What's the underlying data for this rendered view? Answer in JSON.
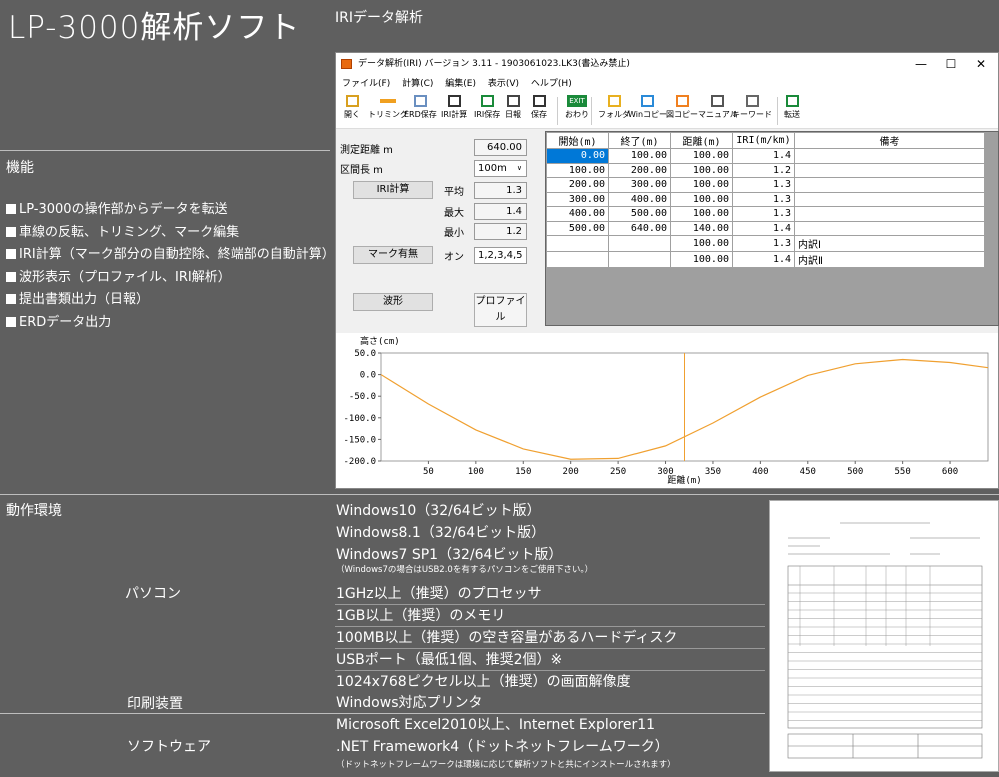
{
  "header": {
    "title": "LP-3000解析ソフト",
    "subtitle": "IRIデータ解析"
  },
  "features": {
    "heading": "機能",
    "items": [
      "LP-3000の操作部からデータを転送",
      "車線の反転、トリミング、マーク編集",
      "IRI計算（マーク部分の自動控除、終端部の自動計算）",
      "波形表示（プロファイル、IRI解析）",
      "提出書類出力（日報）",
      "ERDデータ出力"
    ]
  },
  "window": {
    "title": "データ解析(IRI) バージョン 3.11 - 1903061023.LK3(書込み禁止)",
    "controls": [
      "—",
      "☐",
      "✕"
    ],
    "menu": [
      "ファイル(F)",
      "計算(C)",
      "編集(E)",
      "表示(V)",
      "ヘルプ(H)"
    ],
    "toolbar": [
      {
        "label": "開く",
        "icon": "open-folder-icon"
      },
      {
        "label": "トリミング",
        "icon": "trim-icon"
      },
      {
        "label": "ERD保存",
        "icon": "erd-save-icon"
      },
      {
        "label": "IRI計算",
        "icon": "calculator-icon"
      },
      {
        "label": "IRI保存",
        "icon": "excel-icon"
      },
      {
        "label": "日報",
        "icon": "document-icon"
      },
      {
        "label": "保存",
        "icon": "save-icon"
      },
      {
        "label": "おわり",
        "icon": "exit-icon",
        "text": "EXIT"
      },
      {
        "label": "フォルダ",
        "icon": "folder-icon"
      },
      {
        "label": "Winコピー",
        "icon": "window-copy-icon"
      },
      {
        "label": "図コピー",
        "icon": "figure-copy-icon"
      },
      {
        "label": "マニュアル",
        "icon": "book-icon"
      },
      {
        "label": "キーワード",
        "icon": "keyword-icon"
      },
      {
        "label": "転送",
        "icon": "transfer-icon"
      }
    ],
    "left": {
      "dist_label": "測定距離 m",
      "dist_value": "640.00",
      "interval_label": "区間長 m",
      "interval_value": "100m",
      "iri_btn": "IRI計算",
      "avg_label": "平均",
      "avg_value": "1.3",
      "max_label": "最大",
      "max_value": "1.4",
      "min_label": "最小",
      "min_value": "1.2",
      "mark_btn": "マーク有無",
      "mark_on_label": "オン",
      "mark_values": "1,2,3,4,5",
      "wave_btn": "波形",
      "profile_btn": "プロファイル"
    },
    "table": {
      "headers": [
        "開始(m)",
        "終了(m)",
        "距離(m)",
        "IRI(m/km)",
        "備考"
      ],
      "rows": [
        [
          "0.00",
          "100.00",
          "100.00",
          "1.4",
          ""
        ],
        [
          "100.00",
          "200.00",
          "100.00",
          "1.2",
          ""
        ],
        [
          "200.00",
          "300.00",
          "100.00",
          "1.3",
          ""
        ],
        [
          "300.00",
          "400.00",
          "100.00",
          "1.3",
          ""
        ],
        [
          "400.00",
          "500.00",
          "100.00",
          "1.3",
          ""
        ],
        [
          "500.00",
          "640.00",
          "140.00",
          "1.4",
          ""
        ],
        [
          "",
          "",
          "100.00",
          "1.3",
          "内訳Ⅰ"
        ],
        [
          "",
          "",
          "100.00",
          "1.4",
          "内訳Ⅱ"
        ]
      ]
    },
    "chart_data": {
      "type": "line",
      "ylabel": "高さ(cm)",
      "xlabel": "距離(m)",
      "xlim": [
        0,
        640
      ],
      "ylim": [
        -200,
        50
      ],
      "xticks": [
        50,
        100,
        150,
        200,
        250,
        300,
        350,
        400,
        450,
        500,
        550,
        600
      ],
      "yticks": [
        "50.0",
        "0.0",
        "-50.0",
        "-100.0",
        "-150.0",
        "-200.0"
      ],
      "cursor_x": 320,
      "color": "#f0a030",
      "x": [
        0,
        50,
        100,
        150,
        200,
        250,
        300,
        350,
        400,
        450,
        500,
        550,
        600,
        640
      ],
      "y": [
        0,
        -68,
        -128,
        -172,
        -196,
        -194,
        -165,
        -112,
        -52,
        -2,
        25,
        35,
        28,
        16
      ]
    }
  },
  "environment": {
    "heading": "動作環境",
    "pc_label": "パソコン",
    "os": [
      "Windows10（32/64ビット版）",
      "Windows8.1（32/64ビット版）",
      "Windows7 SP1（32/64ビット版）"
    ],
    "os_note": "（Windows7の場合はUSB2.0を有するパソコンをご使用下さい。）",
    "hw": [
      "1GHz以上（推奨）のプロセッサ",
      "1GB以上（推奨）のメモリ",
      "100MB以上（推奨）の空き容量があるハードディスク",
      "USBポート（最低1個、推奨2個）※",
      "1024x768ピクセル以上（推奨）の画面解像度"
    ],
    "printer_label": "印刷装置",
    "printer": "Windows対応プリンタ",
    "software_label": "ソフトウェア",
    "software": [
      "Microsoft Excel2010以上、Internet Explorer11",
      ".NET Framework4（ドットネットフレームワーク）"
    ],
    "software_note": "（ドットネットフレームワークは環境に応じて解析ソフトと共にインストールされます）"
  }
}
